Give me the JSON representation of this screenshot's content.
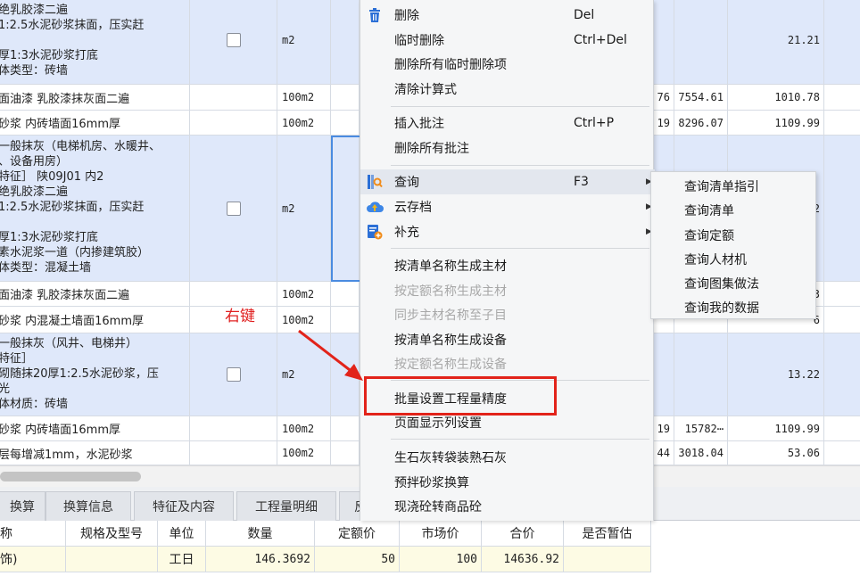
{
  "grid": {
    "rows": [
      {
        "desc": "绝乳胶漆二遍\n1:2.5水泥砂浆抹面，压实赶\n\n厚1:3水泥砂浆打底\n体类型：砖墙",
        "unit": "m2",
        "col_a": "",
        "col_b": "",
        "col_c": "21.21"
      },
      {
        "desc": "面油漆 乳胶漆抹灰面二遍",
        "unit": "100m2",
        "col_a": "76",
        "col_b": "7554.61",
        "col_c": "1010.78"
      },
      {
        "desc": "砂浆 内砖墙面16mm厚",
        "unit": "100m2",
        "col_a": "19",
        "col_b": "8296.07",
        "col_c": "1109.99"
      },
      {
        "desc": "一般抹灰（电梯机房、水暖井、\n、设备用房）\n特征］ 陕09J01 内2\n绝乳胶漆二遍\n1:2.5水泥砂浆抹面，压实赶\n\n厚1:3水泥砂浆打底\n素水泥浆一道（内掺建筑胶）\n体类型：混凝土墙",
        "unit": "m2",
        "col_a": "",
        "col_b": "",
        "col_c": "2"
      },
      {
        "desc": "面油漆 乳胶漆抹灰面二遍",
        "unit": "100m2",
        "col_a": "",
        "col_b": "",
        "col_c": "3"
      },
      {
        "desc": "砂浆 内混凝土墙面16mm厚",
        "unit": "100m2",
        "col_a": "",
        "col_b": "",
        "col_c": "6"
      },
      {
        "desc": "一般抹灰（风井、电梯井）\n特征］\n砌随抹20厚1:2.5水泥砂浆，压\n光\n体材质：砖墙",
        "unit": "m2",
        "col_a": "",
        "col_b": "",
        "col_c": "13.22"
      },
      {
        "desc": "砂浆 内砖墙面16mm厚",
        "unit": "100m2",
        "col_a": "19",
        "col_b": "15782⋯",
        "col_c": "1109.99"
      },
      {
        "desc": "层每增减1mm，水泥砂浆",
        "unit": "100m2",
        "col_a": "44",
        "col_b": "3018.04",
        "col_c": "53.06"
      }
    ]
  },
  "tabs": [
    "换算",
    "换算信息",
    "特征及内容",
    "工程量明细",
    "反"
  ],
  "lower_table": {
    "headers": [
      "称",
      "规格及型号",
      "单位",
      "数量",
      "定额价",
      "市场价",
      "合价",
      "是否暂估"
    ],
    "row": [
      "饰)",
      "",
      "工日",
      "146.3692",
      "50",
      "100",
      "14636.92",
      ""
    ]
  },
  "context_menu": {
    "items": [
      {
        "label": "删除",
        "shortcut": "Del",
        "icon": "trash-icon"
      },
      {
        "label": "临时删除",
        "shortcut": "Ctrl+Del"
      },
      {
        "label": "删除所有临时删除项",
        "shortcut": ""
      },
      {
        "label": "清除计算式",
        "shortcut": ""
      },
      {
        "label": "插入批注",
        "shortcut": "Ctrl+P"
      },
      {
        "label": "删除所有批注",
        "shortcut": ""
      },
      {
        "label": "查询",
        "shortcut": "F3",
        "icon": "query-icon",
        "submenu": true
      },
      {
        "label": "云存档",
        "shortcut": "",
        "icon": "cloud-upload-icon",
        "submenu": true
      },
      {
        "label": "补充",
        "shortcut": "",
        "icon": "add-supplement-icon",
        "submenu": true
      },
      {
        "label": "按清单名称生成主材",
        "shortcut": ""
      },
      {
        "label": "按定额名称生成主材",
        "shortcut": "",
        "disabled": true
      },
      {
        "label": "同步主材名称至子目",
        "shortcut": "",
        "disabled": true
      },
      {
        "label": "按清单名称生成设备",
        "shortcut": ""
      },
      {
        "label": "按定额名称生成设备",
        "shortcut": "",
        "disabled": true
      },
      {
        "label": "批量设置工程量精度",
        "shortcut": ""
      },
      {
        "label": "页面显示列设置",
        "shortcut": ""
      },
      {
        "label": "生石灰转袋装熟石灰",
        "shortcut": ""
      },
      {
        "label": "预拌砂浆换算",
        "shortcut": ""
      },
      {
        "label": "现浇砼转商品砼",
        "shortcut": ""
      }
    ]
  },
  "submenu": {
    "items": [
      "查询清单指引",
      "查询清单",
      "查询定额",
      "查询人材机",
      "查询图集做法",
      "查询我的数据"
    ]
  },
  "annotation": {
    "label": "右键",
    "color": "#e2231a"
  }
}
